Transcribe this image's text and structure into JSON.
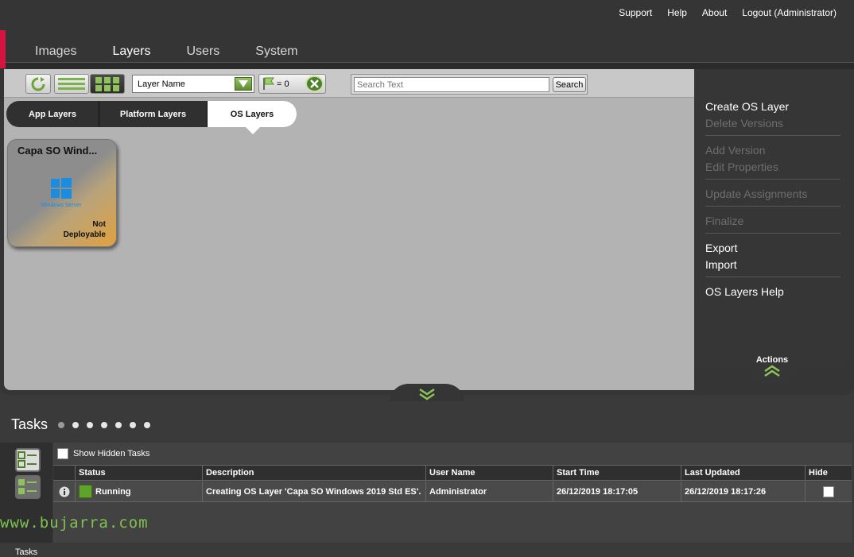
{
  "header": {
    "links": [
      "Support",
      "Help",
      "About",
      "Logout (Administrator)"
    ]
  },
  "nav": {
    "tabs": [
      {
        "label": "Images",
        "active": false
      },
      {
        "label": "Layers",
        "active": true
      },
      {
        "label": "Users",
        "active": false
      },
      {
        "label": "System",
        "active": false
      }
    ]
  },
  "toolbar": {
    "sort_select_value": "Layer Name",
    "flag_count": "= 0",
    "search_placeholder": "Search Text",
    "search_button": "Search"
  },
  "subtabs": [
    {
      "label": "App Layers"
    },
    {
      "label": "Platform Layers"
    },
    {
      "label": "OS Layers",
      "active": true
    }
  ],
  "layer_card": {
    "title": "Capa SO Wind...",
    "logo_text": "Windows Server",
    "status_line1": "Not",
    "status_line2": "Deployable"
  },
  "actions": {
    "label": "Actions",
    "items": [
      {
        "label": "Create OS Layer",
        "enabled": true
      },
      {
        "label": "Delete Versions",
        "enabled": false
      },
      {
        "label": "Add Version",
        "enabled": false
      },
      {
        "label": "Edit Properties",
        "enabled": false
      },
      {
        "label": "Update Assignments",
        "enabled": false
      },
      {
        "label": "Finalize",
        "enabled": false
      },
      {
        "label": "Export",
        "enabled": true
      },
      {
        "label": "Import",
        "enabled": true
      },
      {
        "label": "OS Layers Help",
        "enabled": true
      }
    ]
  },
  "tasks": {
    "title": "Tasks",
    "side_label": "Tasks",
    "show_hidden_label": "Show Hidden Tasks",
    "columns": [
      "Status",
      "Description",
      "User Name",
      "Start Time",
      "Last Updated",
      "Hide"
    ],
    "rows": [
      {
        "status": "Running",
        "description": "Creating OS Layer 'Capa SO Windows 2019 Std ES'.",
        "user": "Administrator",
        "start": "26/12/2019 18:17:05",
        "updated": "26/12/2019 18:17:26"
      }
    ]
  },
  "watermark": "www.bujarra.com",
  "colors": {
    "accent_red": "#d5153f",
    "status_green": "#5fa32b",
    "windows_blue": "#1a8de0"
  }
}
